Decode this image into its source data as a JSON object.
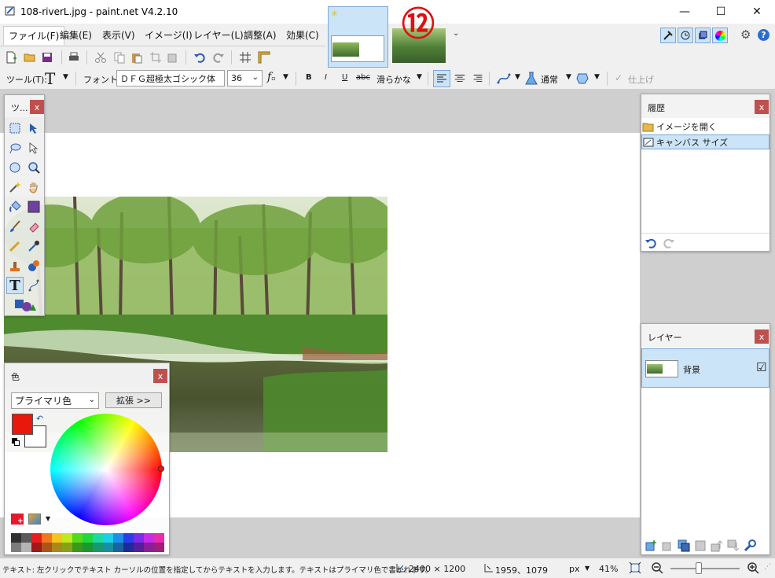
{
  "window": {
    "title": "108-riverL.jpg - paint.net V4.2.10",
    "minimize": "—",
    "maximize": "☐",
    "close": "✕"
  },
  "menu": {
    "items": [
      "ファイル(F)",
      "編集(E)",
      "表示(V)",
      "イメージ(I)",
      "レイヤー(L)",
      "調整(A)",
      "効果(C)"
    ]
  },
  "annotation": {
    "marker": "⑫"
  },
  "text_toolbar": {
    "tool_label": "ツール(T):",
    "tool_glyph": "T",
    "font_label": "フォント:",
    "font_value": "ＤＦＧ超極太ゴシック体",
    "size_value": "36",
    "bold": "B",
    "italic": "I",
    "underline": "U",
    "strike": "abc",
    "antialias": "滑らかな",
    "blend_mode": "通常",
    "finish": "仕上げ"
  },
  "tools_panel": {
    "title": "ツ...",
    "close": "x"
  },
  "history_panel": {
    "title": "履歴",
    "close": "x",
    "items": [
      "イメージを開く",
      "キャンバス サイズ"
    ]
  },
  "layers_panel": {
    "title": "レイヤー",
    "close": "x",
    "layer_name": "背景",
    "checkbox": "☑"
  },
  "colors_panel": {
    "title": "色",
    "close": "x",
    "mode": "プライマリ色",
    "expand": "拡張 >>",
    "primary_color": "#e8180c",
    "secondary_color": "#ffffff"
  },
  "palette": {
    "row1": [
      "#303030",
      "#5a5a5a",
      "#e81e1e",
      "#f4761e",
      "#f5c21e",
      "#c2e81e",
      "#56d81e",
      "#1ed83c",
      "#1ed8a0",
      "#1ecfe8",
      "#1e8ee8",
      "#2c3ce8",
      "#7a2ce8",
      "#c62ce8",
      "#e82cb0"
    ],
    "row2": [
      "#7c7c7c",
      "#b4b4b4",
      "#a01818",
      "#aa5418",
      "#a88818",
      "#88a018",
      "#3c9818",
      "#189830",
      "#189870",
      "#1890a0",
      "#1864a0",
      "#1e2a9c",
      "#541e9c",
      "#8a1e9c",
      "#a01e7c"
    ]
  },
  "status": {
    "hint": "テキスト: 左クリックでテキスト カーソルの位置を指定してからテキストを入力します。テキストはプライマリ色で書かれます。",
    "image_size": "2400 × 1200",
    "cursor_pos": "1959、1079",
    "unit": "px",
    "zoom": "41%"
  },
  "colors": {
    "accent_blue": "#cce4f7",
    "close_red": "#c0504d",
    "selection_border": "#7aa7d6"
  }
}
